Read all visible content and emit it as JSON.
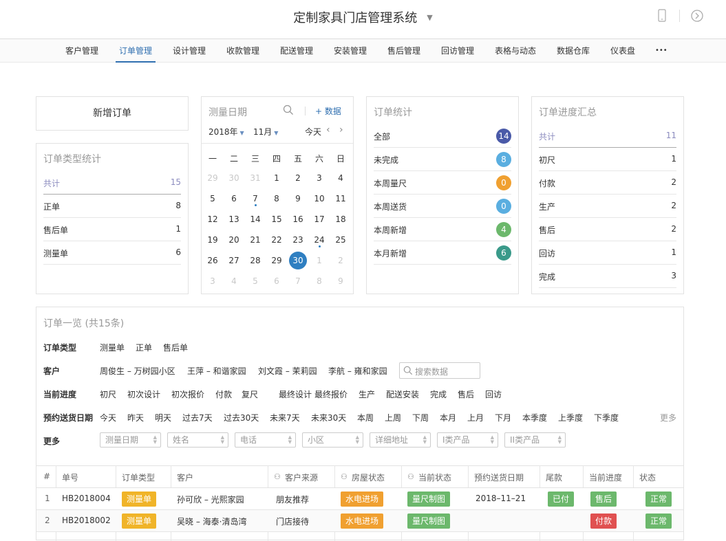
{
  "header": {
    "title": "定制家具门店管理系统",
    "caret": "▼",
    "phone_icon": "phone-icon",
    "compass_icon": "compass-icon"
  },
  "nav": {
    "items": [
      "客户管理",
      "订单管理",
      "设计管理",
      "收款管理",
      "配送管理",
      "安装管理",
      "售后管理",
      "回访管理",
      "表格与动态",
      "数据仓库",
      "仪表盘",
      "•••"
    ],
    "active": 1
  },
  "new_order": {
    "label": "新增订单"
  },
  "order_type_stats": {
    "title": "订单类型统计",
    "total_label": "共计",
    "total": "15",
    "rows": [
      {
        "label": "正单",
        "value": "8"
      },
      {
        "label": "售后单",
        "value": "1"
      },
      {
        "label": "测量单",
        "value": "6"
      }
    ]
  },
  "calendar": {
    "title": "测量日期",
    "add_label": "+ 数据",
    "year": "2018年",
    "month": "11月",
    "today_label": "今天",
    "weekdays": [
      "一",
      "二",
      "三",
      "四",
      "五",
      "六",
      "日"
    ],
    "weeks": [
      [
        "29",
        "30",
        "31",
        "1",
        "2",
        "3",
        "4"
      ],
      [
        "5",
        "6",
        "7",
        "8",
        "9",
        "10",
        "11"
      ],
      [
        "12",
        "13",
        "14",
        "15",
        "16",
        "17",
        "18"
      ],
      [
        "19",
        "20",
        "21",
        "22",
        "23",
        "24",
        "25"
      ],
      [
        "26",
        "27",
        "28",
        "29",
        "30",
        "1",
        "2"
      ],
      [
        "3",
        "4",
        "5",
        "6",
        "7",
        "8",
        "9"
      ]
    ],
    "selected": "30"
  },
  "order_stats": {
    "title": "订单统计",
    "rows": [
      {
        "label": "全部",
        "value": "14",
        "color": "#4a5aa8"
      },
      {
        "label": "未完成",
        "value": "8",
        "color": "#5aaee0"
      },
      {
        "label": "本周量尺",
        "value": "0",
        "color": "#f0a030"
      },
      {
        "label": "本周送货",
        "value": "0",
        "color": "#5aaee0"
      },
      {
        "label": "本周新增",
        "value": "4",
        "color": "#6cb86c"
      },
      {
        "label": "本月新增",
        "value": "6",
        "color": "#3a9a8a"
      }
    ]
  },
  "progress_summary": {
    "title": "订单进度汇总",
    "total_label": "共计",
    "total": "11",
    "rows": [
      {
        "label": "初尺",
        "value": "1"
      },
      {
        "label": "付款",
        "value": "2"
      },
      {
        "label": "生产",
        "value": "2"
      },
      {
        "label": "售后",
        "value": "2"
      },
      {
        "label": "回访",
        "value": "1"
      },
      {
        "label": "完成",
        "value": "3"
      }
    ]
  },
  "order_list": {
    "title": "订单一览 (共15条)",
    "filters": {
      "type": {
        "label": "订单类型",
        "options": [
          "测量单",
          "正单",
          "售后单"
        ]
      },
      "customer": {
        "label": "客户",
        "options": [
          "周俊生 – 万树园小区",
          "王萍 – 和谐家园",
          "刘文霞 – 茉莉园",
          "李航 – 雍和家园"
        ],
        "search_placeholder": "搜索数据"
      },
      "progress": {
        "label": "当前进度",
        "options": [
          "初尺",
          "初次设计",
          "初次报价",
          "付款",
          "复尺",
          "最终设计",
          "最终报价",
          "生产",
          "配送安装",
          "完成",
          "售后",
          "回访"
        ]
      },
      "delivery": {
        "label": "预约送货日期",
        "options": [
          "今天",
          "昨天",
          "明天",
          "过去7天",
          "过去30天",
          "未来7天",
          "未来30天",
          "本周",
          "上周",
          "下周",
          "本月",
          "上月",
          "下月",
          "本季度",
          "上季度",
          "下季度"
        ],
        "more": "更多"
      },
      "more": {
        "label": "更多",
        "fields": [
          "测量日期",
          "姓名",
          "电话",
          "小区",
          "详细地址",
          "I类产品",
          "II类产品"
        ]
      }
    },
    "columns": [
      "#",
      "单号",
      "订单类型",
      "客户",
      "客户来源",
      "房屋状态",
      "当前状态",
      "预约送货日期",
      "尾款",
      "当前进度",
      "状态"
    ],
    "rows": [
      {
        "no": "1",
        "id": "HB2018004",
        "type": {
          "text": "测量单",
          "color": "#f0b429"
        },
        "customer": "孙可欣 – 光熙家园",
        "source": "朋友推荐",
        "house": {
          "text": "水电进场",
          "color": "#f0a030"
        },
        "status": {
          "text": "量尺制图",
          "color": "#6cb86c"
        },
        "date": "2018–11–21",
        "balance": {
          "text": "已付",
          "color": "#6cb86c"
        },
        "progress": {
          "text": "售后",
          "color": "#6cb86c"
        },
        "state": {
          "text": "正常",
          "color": "#6cb86c"
        }
      },
      {
        "no": "2",
        "id": "HB2018002",
        "type": {
          "text": "测量单",
          "color": "#f0b429"
        },
        "customer": "吴晓 – 海泰·清岛湾",
        "source": "门店接待",
        "house": {
          "text": "水电进场",
          "color": "#f0a030"
        },
        "status": {
          "text": "量尺制图",
          "color": "#6cb86c"
        },
        "date": "",
        "balance": {
          "text": "",
          "color": ""
        },
        "progress": {
          "text": "付款",
          "color": "#e05050"
        },
        "state": {
          "text": "正常",
          "color": "#6cb86c"
        }
      }
    ]
  }
}
